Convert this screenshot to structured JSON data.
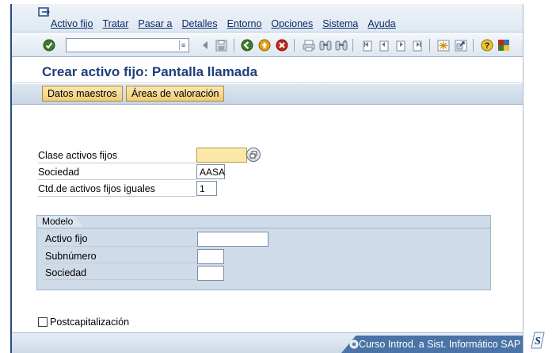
{
  "menubar": {
    "items": [
      "Activo fijo",
      "Tratar",
      "Pasar a",
      "Detalles",
      "Entorno",
      "Opciones",
      "Sistema",
      "Ayuda"
    ]
  },
  "toolbar": {
    "command_value": "",
    "icons": [
      "enter-icon",
      "save-icon",
      "back-icon",
      "exit-icon",
      "cancel-icon",
      "print-icon",
      "find-icon",
      "find-next-icon",
      "first-page-icon",
      "prev-page-icon",
      "next-page-icon",
      "last-page-icon",
      "new-session-icon",
      "shortcut-icon",
      "help-icon",
      "customize-layout-icon"
    ]
  },
  "title": "Crear activo fijo:  Pantalla llamada",
  "apptoolbar": {
    "btn1": "Datos maestros",
    "btn2": "Áreas de valoración"
  },
  "form": {
    "clase_label": "Clase activos fijos",
    "clase_value": "",
    "sociedad_label": "Sociedad",
    "sociedad_value": "AASA",
    "ctd_label": "Ctd.de activos fijos iguales",
    "ctd_value": "1"
  },
  "modelo": {
    "title": "Modelo",
    "activo_label": "Activo fijo",
    "activo_value": "",
    "subnum_label": "Subnúmero",
    "subnum_value": "",
    "sociedad_label": "Sociedad",
    "sociedad_value": ""
  },
  "postcap": {
    "label": "Postcapitalización",
    "checked": false
  },
  "statusbar": {
    "text": "Curso Introd. a Sist. Informático SAP"
  }
}
